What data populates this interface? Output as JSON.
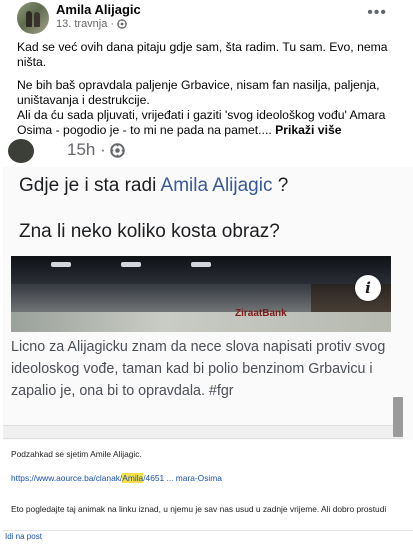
{
  "post": {
    "author": "Amila Alijagic",
    "date": "13. travnja",
    "more_icon": "ellipsis-icon",
    "paragraph1": "Kad se već ovih dana pitaju gdje sam, šta radim. Tu sam. Evo, nema ništa.",
    "paragraph2_a": "Ne bih baš opravdala paljenje Grbavice, nisam fan nasilja, paljenja, uništavanja i destrukcije.",
    "paragraph2_b": "Ali da ću sada pljuvati, vrijeđati i gaziti 'svog ideološkog vođu' Amara Osima - pogodio je - to mi ne pada na pamet....",
    "see_more": "Prikaži više"
  },
  "screenshot": {
    "time": "15h ·",
    "question1_prefix": "Gdje je i sta radi",
    "question1_name": "Amila Alijagic",
    "question1_suffix": "?",
    "question2": "Zna li neko koliko kosta obraz?",
    "banner_logo": "ZiraatBank",
    "info_icon": "i",
    "comment": "Licno za Alijagicku znam da nece slova napisati protiv svog ideoloskog vođe, taman kad bi polio benzinom Grbavicu i zapalio je, ona bi to opravdala. #fgr"
  },
  "email": {
    "line1": "Podzahkad se sjetim Amile Alijagic.",
    "url_prefix": "https://www.aource.ba/clanak/",
    "url_highlight": "Amila",
    "url_suffix": "/4651 ... mara-Osima",
    "line3": "Eto pogledajte taj animak na linku iznad, u njemu je sav nas usud u zadnje vrijeme. Ali dobro prostudi",
    "footer_link": "Idi na post"
  },
  "colors": {
    "link": "#385898",
    "email_link": "#1a4fb0",
    "highlight": "#f5e04a",
    "secondary_text": "#65676b"
  }
}
